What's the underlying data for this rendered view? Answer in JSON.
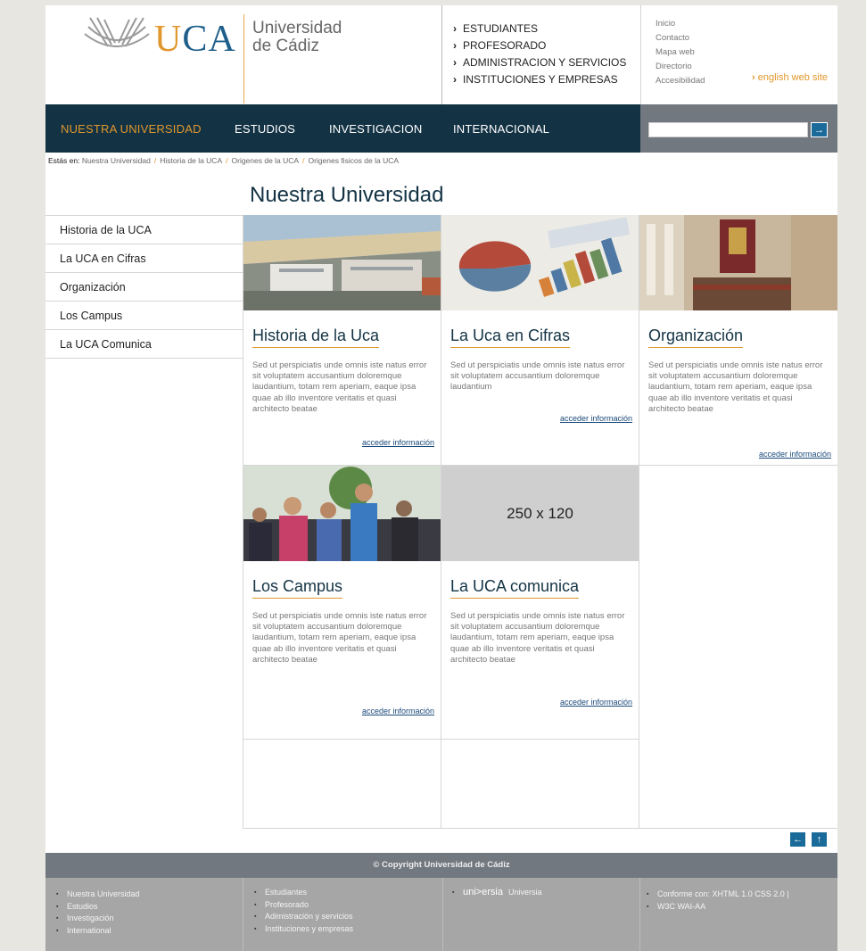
{
  "header": {
    "logo_text": "UCA",
    "logo_name_line1": "Universidad",
    "logo_name_line2": "de Cádiz",
    "audience_links": [
      "ESTUDIANTES",
      "PROFESORADO",
      "ADMINISTRACION Y SERVICIOS",
      "INSTITUCIONES Y EMPRESAS"
    ],
    "utility_links": [
      "Inicio",
      "Contacto",
      "Mapa web",
      "Directorio",
      "Accesibilidad"
    ],
    "english_link": "english web site"
  },
  "nav": {
    "items": [
      "NUESTRA  UNIVERSIDAD",
      "ESTUDIOS",
      "INVESTIGACION",
      "INTERNACIONAL"
    ],
    "active_index": 0,
    "search_placeholder": "",
    "search_button_icon": "arrow-right-icon"
  },
  "breadcrumb": {
    "label": "Estás en:",
    "items": [
      "Nuestra Universidad",
      "Historia de la UCA",
      "Origenes de la UCA",
      "Origenes fisicos de la UCA"
    ]
  },
  "main": {
    "title": "Nuestra Universidad"
  },
  "sidebar": {
    "items": [
      "Historia de la UCA",
      "La UCA en Cifras",
      "Organización",
      "Los Campus",
      "La UCA Comunica"
    ]
  },
  "cards": [
    {
      "title": "Historia de la Uca",
      "text": "Sed ut perspiciatis unde omnis iste natus error sit voluptatem accusantium doloremque laudantium, totam rem aperiam, eaque ipsa quae ab illo inventore veritatis et quasi architecto beatae",
      "link": "acceder información"
    },
    {
      "title": "La Uca en Cifras",
      "text": "Sed ut perspiciatis unde omnis iste natus error sit voluptatem accusantium doloremque laudantium",
      "link": "acceder información"
    },
    {
      "title": "Organización",
      "text": "Sed ut perspiciatis unde omnis iste natus error sit voluptatem accusantium doloremque laudantium, totam rem aperiam, eaque ipsa quae ab illo inventore veritatis et quasi architecto beatae",
      "link": "acceder información"
    },
    {
      "title": "Los Campus",
      "text": "Sed ut perspiciatis unde omnis iste natus error sit voluptatem accusantium doloremque laudantium, totam rem aperiam, eaque ipsa quae ab illo inventore veritatis et quasi architecto beatae",
      "link": "acceder información"
    },
    {
      "title": "La UCA comunica",
      "placeholder": "250 x 120",
      "text": "Sed ut perspiciatis unde omnis iste natus error sit voluptatem accusantium doloremque laudantium, totam rem aperiam, eaque ipsa quae ab illo inventore veritatis et quasi architecto beatae",
      "link": "acceder información"
    }
  ],
  "pager": {
    "prev_icon": "arrow-left-icon",
    "next_icon": "arrow-up-icon"
  },
  "footer": {
    "copyright": "© Copyright Universidad de Cádiz",
    "col1": [
      "Nuestra Universidad",
      "Estudios",
      "Investigación",
      "International"
    ],
    "col2": [
      "Estudiantes",
      "Profesorado",
      "Adimistración y servicios",
      "Instituciones y empresas"
    ],
    "col3_logo": "uni>ersia",
    "col3_text": "Universia",
    "col4": [
      "Conforme con: XHTML 1.0  CSS 2.0 |",
      "W3C  WAI-AA"
    ]
  },
  "colors": {
    "navy": "#133345",
    "orange": "#e0972c",
    "footer_bar": "#727880",
    "footer_bg": "#a7a6a6"
  }
}
